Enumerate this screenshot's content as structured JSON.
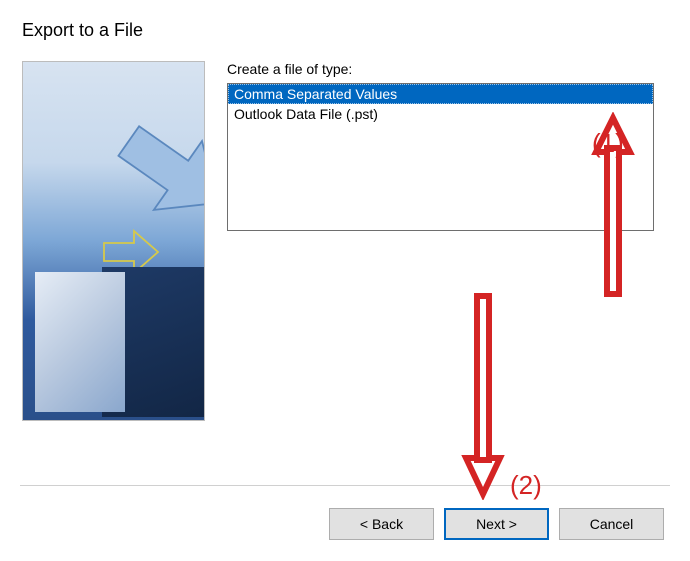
{
  "title": "Export to a File",
  "section_label": "Create a file of type:",
  "file_types": [
    {
      "label": "Comma Separated Values",
      "selected": true
    },
    {
      "label": "Outlook Data File (.pst)",
      "selected": false
    }
  ],
  "buttons": {
    "back": "< Back",
    "next": "Next >",
    "cancel": "Cancel"
  },
  "annotations": {
    "label1": "(1)",
    "label2": "(2)"
  }
}
